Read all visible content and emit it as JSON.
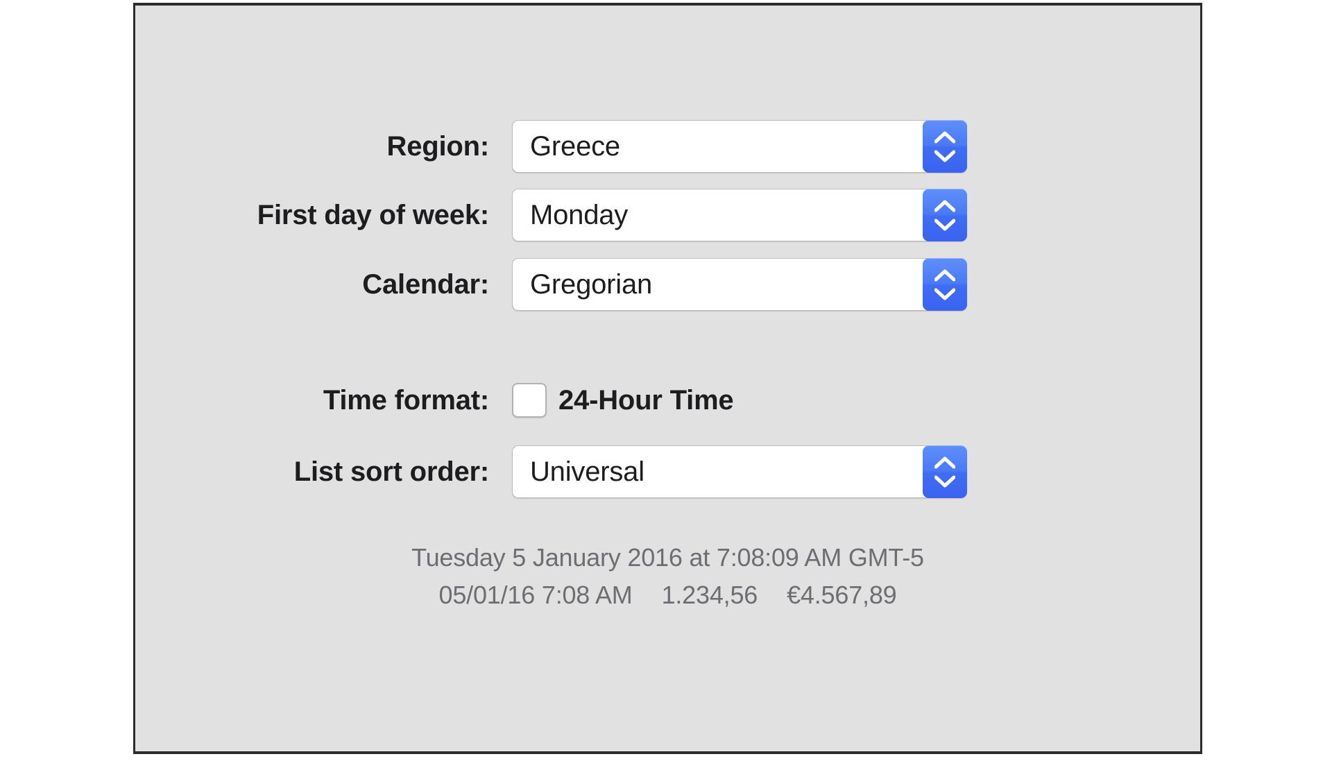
{
  "panel": {
    "name": "Language & Region preferences pane",
    "background_color": "#E1E1E1",
    "border_color": "#2C2C2C"
  },
  "accent_color": "#4A7AF6",
  "form": {
    "rows": [
      {
        "label": "Region:",
        "control": "popup-button",
        "value": "Greece",
        "stepper_icon": "chevron-up-down-icon"
      },
      {
        "label": "First day of week:",
        "control": "popup-button",
        "value": "Monday",
        "stepper_icon": "chevron-up-down-icon"
      },
      {
        "label": "Calendar:",
        "control": "popup-button",
        "value": "Gregorian",
        "stepper_icon": "chevron-up-down-icon"
      },
      {
        "label": "Time format:",
        "control": "checkbox",
        "checkbox_label": "24-Hour Time",
        "checked": false
      },
      {
        "label": "List sort order:",
        "control": "popup-button",
        "value": "Universal",
        "stepper_icon": "chevron-up-down-icon"
      }
    ]
  },
  "preview": {
    "long_date": "Tuesday 5 January 2016 at 7:08:09 AM GMT-5",
    "short_date": "05/01/16 7:08 AM",
    "number_sample": "1.234,56",
    "currency_sample": "€4.567,89"
  }
}
